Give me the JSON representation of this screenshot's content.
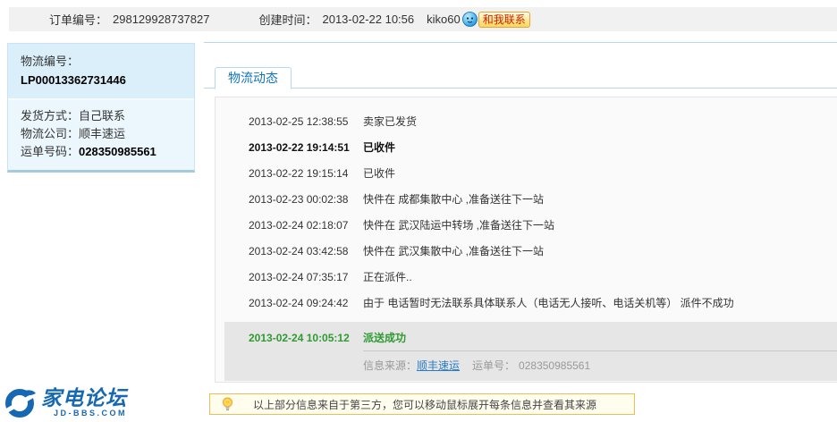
{
  "header": {
    "order_label": "订单编号：",
    "order_number": "298129928737827",
    "created_label": "创建时间：",
    "created_time": "2013-02-22 10:56",
    "seller_name": "kiko60",
    "contact_badge": "和我联系"
  },
  "sidebar": {
    "logistics_no_label": "物流编号：",
    "logistics_no": "LP00013362731446",
    "fields": [
      {
        "label": "发货方式：",
        "value": "自己联系",
        "bold": false
      },
      {
        "label": "物流公司：",
        "value": "顺丰速运",
        "bold": false
      },
      {
        "label": "运单号码：",
        "value": "028350985561",
        "bold": true
      }
    ]
  },
  "main": {
    "tab_label": "物流动态",
    "events": [
      {
        "time": "2013-02-25 12:38:55",
        "desc": "卖家已发货",
        "bold": false
      },
      {
        "time": "2013-02-22 19:14:51",
        "desc": "已收件",
        "bold": true
      },
      {
        "time": "2013-02-22 19:15:14",
        "desc": "已收件",
        "bold": false
      },
      {
        "time": "2013-02-23 00:02:38",
        "desc": "快件在 成都集散中心 ,准备送往下一站",
        "bold": false
      },
      {
        "time": "2013-02-24 02:18:07",
        "desc": "快件在 武汉陆运中转场 ,准备送往下一站",
        "bold": false
      },
      {
        "time": "2013-02-24 03:42:58",
        "desc": "快件在 武汉集散中心 ,准备送往下一站",
        "bold": false
      },
      {
        "time": "2013-02-24 07:35:17",
        "desc": "正在派件..",
        "bold": false
      },
      {
        "time": "2013-02-24 09:24:42",
        "desc": "由于 电话暂时无法联系具体联系人（电话无人接听、电话关机等） 派件不成功",
        "bold": false
      }
    ],
    "final_event": {
      "time": "2013-02-24 10:05:12",
      "desc": "派送成功",
      "source_label": "信息来源：",
      "source_link": "顺丰速运",
      "waybill_label": "运单号：",
      "waybill_no": "028350985561"
    },
    "tip": "以上部分信息来自于第三方，您可以移动鼠标展开每条信息并查看其来源"
  },
  "footer": {
    "logo_text": "家电论坛",
    "logo_sub": "JD-BBS.COM"
  },
  "colors": {
    "accent_blue": "#1274bc",
    "link_blue": "#2a7cc7",
    "success_green": "#2f9a32",
    "badge_text_red": "#cc2200",
    "logo_blue": "#1668b2",
    "highlight_row_bg": "#e6e6e6",
    "sidebar_bg": "#daeffa",
    "tip_bg": "#fffdee"
  }
}
